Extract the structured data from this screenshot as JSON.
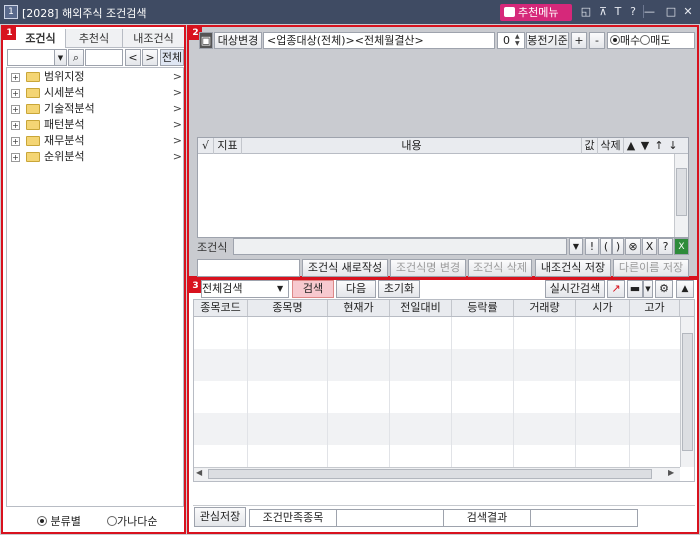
{
  "titlebar": {
    "app_number": "1",
    "title": "[2028] 해외주식 조건검색",
    "recommend_menu": "추천메뉴",
    "icons": [
      "window-icon",
      "pin-icon",
      "text-icon",
      "help-icon",
      "minimize-icon",
      "maximize-icon",
      "close-icon"
    ]
  },
  "left": {
    "badge": "1",
    "tabs": [
      "조건식",
      "추천식",
      "내조건식"
    ],
    "search_value": "",
    "all_button": "전체",
    "tree": [
      "범위지정",
      "시세분석",
      "기술적분석",
      "패턴분석",
      "재무분석",
      "순위분석"
    ],
    "sort_options": [
      "분류별",
      "가나다순"
    ],
    "sort_selected": "분류별"
  },
  "condition": {
    "badge": "2",
    "target_change_button": "대상변경",
    "target_text": "<업종대상(전체)><전체월결산>",
    "offset_value": "0",
    "base_label": "봉전기준",
    "plus": "+",
    "minus": "-",
    "buy": "매수",
    "sell": "매도",
    "trade_selected": "매수",
    "table_headers": [
      "√",
      "지표",
      "내용",
      "값",
      "삭제",
      "▲",
      "▼",
      "↑",
      "↓"
    ],
    "formula_label": "조건식",
    "formula_value": "",
    "formula_ops": [
      "▼",
      "!",
      "(",
      ")",
      "⊗",
      "X",
      "?"
    ],
    "name_value": "",
    "buttons": [
      "조건식 새로작성",
      "조건식명 변경",
      "조건식 삭제",
      "내조건식 저장",
      "다른이름 저장"
    ]
  },
  "results": {
    "badge": "3",
    "scope_select": "전체검색",
    "search_button": "검색",
    "next_button": "다음",
    "reset_button": "초기화",
    "realtime_button": "실시간검색",
    "columns": [
      "종목코드",
      "종목명",
      "현재가",
      "전일대비",
      "등락률",
      "거래량",
      "시가",
      "고가"
    ],
    "rows": [],
    "save_interest": "관심저장",
    "match_label": "조건만족종목",
    "match_value": "",
    "result_label": "검색결과",
    "result_value": ""
  },
  "colors": {
    "title_bg": "#3f4b63",
    "accent_pink": "#d6287a",
    "panel_border": "#d8121e",
    "search_highlight": "#f7c9cf"
  }
}
